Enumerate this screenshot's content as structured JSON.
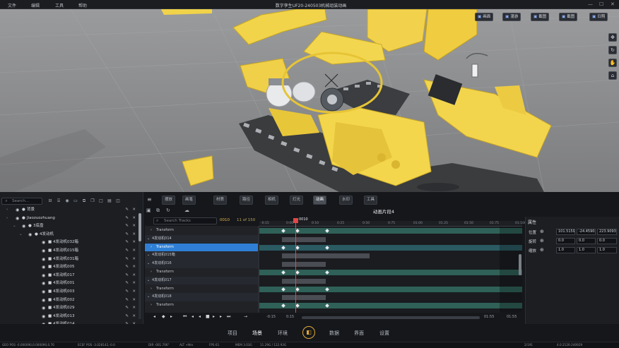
{
  "titlebar": {
    "menus": [
      "文件",
      "编辑",
      "工具",
      "帮助"
    ],
    "title": "数字孪生UF20-240503机械组装动画"
  },
  "viewport": {
    "buttons": [
      "画面",
      "漫游",
      "截图",
      "截图",
      "日照"
    ]
  },
  "left_panel": {
    "search_placeholder": "Search...",
    "tree": [
      {
        "label": "背景",
        "level": 0
      },
      {
        "label": "Jiaozuozhuang",
        "level": 0
      },
      {
        "label": "3底盘",
        "level": 1
      },
      {
        "label": "4发动机",
        "level": 2
      },
      {
        "label": "4发动机032箱",
        "level": 3
      },
      {
        "label": "4发动机015箱",
        "level": 3
      },
      {
        "label": "4发动机031箱",
        "level": 3
      },
      {
        "label": "4发动机005",
        "level": 3
      },
      {
        "label": "4发动机017",
        "level": 3
      },
      {
        "label": "4发动机001",
        "level": 3
      },
      {
        "label": "4发动机003",
        "level": 3
      },
      {
        "label": "4发动机002",
        "level": 3
      },
      {
        "label": "4发动机029",
        "level": 3
      },
      {
        "label": "4发动机013",
        "level": 3
      },
      {
        "label": "4发动机014",
        "level": 3
      }
    ]
  },
  "tabs": [
    {
      "label": "摆放"
    },
    {
      "label": "画笔"
    },
    {
      "label": "材质"
    },
    {
      "label": "路径"
    },
    {
      "label": "相机"
    },
    {
      "label": "灯光"
    },
    {
      "label": "动画"
    },
    {
      "label": "水印"
    },
    {
      "label": "工具"
    }
  ],
  "animation": {
    "clip_title": "动画片段4",
    "search_placeholder": "Search Tracks",
    "current_frame": "0010",
    "frame_count": "11 of 150",
    "tracks": [
      {
        "label": "Transform",
        "kind": "transform"
      },
      {
        "label": "4发动机014",
        "kind": "group"
      },
      {
        "label": "Transform",
        "kind": "transform"
      },
      {
        "label": "4发动机015箱",
        "kind": "group"
      },
      {
        "label": "4发动机016",
        "kind": "group"
      },
      {
        "label": "Transform",
        "kind": "transform"
      },
      {
        "label": "4发动机017",
        "kind": "group"
      },
      {
        "label": "Transform",
        "kind": "transform"
      },
      {
        "label": "4发动机018",
        "kind": "group"
      },
      {
        "label": "Transform",
        "kind": "transform"
      }
    ],
    "ruler_ticks": [
      "-0:15",
      "0:00",
      "0:10",
      "0:25",
      "0:50",
      "0:75",
      "01:00",
      "01:25",
      "01:50",
      "01:75",
      "01:100"
    ],
    "playhead_label": "0010",
    "range_start": "-0:15",
    "range_in": "0:15",
    "range_out": "01:55",
    "range_end": "01:55"
  },
  "properties": {
    "title": "属性",
    "rows": [
      {
        "label": "位置",
        "values": [
          "101.5159",
          "-24.45908",
          "223.9093"
        ]
      },
      {
        "label": "旋转",
        "values": [
          "0.0",
          "0.0",
          "0.0"
        ]
      },
      {
        "label": "缩放",
        "values": [
          "1.0",
          "1.0",
          "1.0"
        ]
      }
    ]
  },
  "bottom_nav": [
    "项目",
    "场景",
    "环境",
    "数据",
    "界面",
    "设置"
  ],
  "status": {
    "geo": "GEO POS  -0.000090,0.000090,0.76",
    "ecef": "ECEF POS  -3.028142,-0.0",
    "dir": "DIR  -001.706°",
    "alt": "ALT  +Nm",
    "fps": "FPS  61",
    "mem": "MEM  3.03G",
    "tri": "11.29G / 122.93G",
    "page": "2/191",
    "ver": "4.0.2126-240929"
  }
}
